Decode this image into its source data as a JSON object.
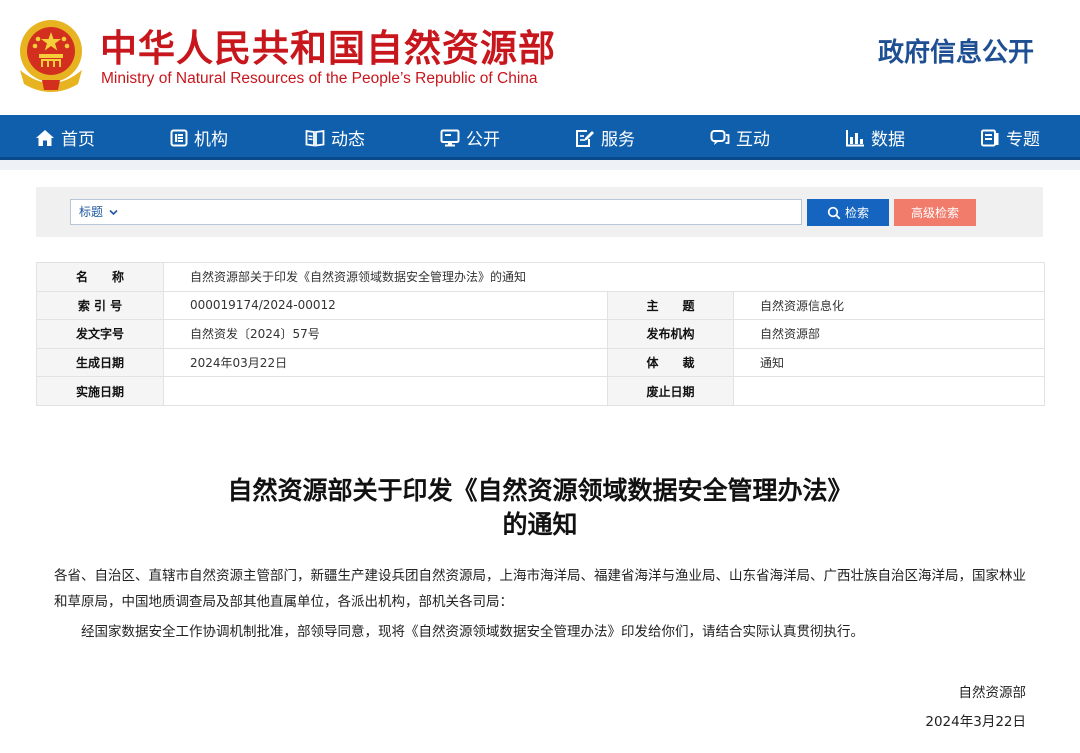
{
  "header": {
    "title": "中华人民共和国自然资源部",
    "subtitle": "Ministry of Natural Resources of the People’s Republic of China",
    "gov_info": "政府信息公开"
  },
  "nav": {
    "items": [
      {
        "label": "首页",
        "icon": "home-icon"
      },
      {
        "label": "机构",
        "icon": "org-icon"
      },
      {
        "label": "动态",
        "icon": "book-icon"
      },
      {
        "label": "公开",
        "icon": "monitor-icon"
      },
      {
        "label": "服务",
        "icon": "edit-icon"
      },
      {
        "label": "互动",
        "icon": "chat-icon"
      },
      {
        "label": "数据",
        "icon": "bar-chart-icon"
      },
      {
        "label": "专题",
        "icon": "document-icon"
      }
    ]
  },
  "search": {
    "select_value": "标题",
    "input_value": "",
    "search_label": "检索",
    "advanced_label": "高级检索"
  },
  "meta": {
    "name_label": "名　　称",
    "name_value": "自然资源部关于印发《自然资源领域数据安全管理办法》的通知",
    "index_label": "索 引 号",
    "index_value": "000019174/2024-00012",
    "topic_label": "主　　题",
    "topic_value": "自然资源信息化",
    "docno_label": "发文字号",
    "docno_value": "自然资发〔2024〕57号",
    "publisher_label": "发布机构",
    "publisher_value": "自然资源部",
    "created_label": "生成日期",
    "created_value": "2024年03月22日",
    "genre_label": "体　　裁",
    "genre_value": "通知",
    "effective_label": "实施日期",
    "effective_value": "",
    "repeal_label": "废止日期",
    "repeal_value": ""
  },
  "article": {
    "title_line1": "自然资源部关于印发《自然资源领域数据安全管理办法》",
    "title_line2": "的通知",
    "recipients": "各省、自治区、直辖市自然资源主管部门，新疆生产建设兵团自然资源局，上海市海洋局、福建省海洋与渔业局、山东省海洋局、广西壮族自治区海洋局，国家林业和草原局，中国地质调查局及部其他直属单位，各派出机构，部机关各司局：",
    "body": "经国家数据安全工作协调机制批准，部领导同意，现将《自然资源领域数据安全管理办法》印发给你们，请结合实际认真贯彻执行。",
    "signer": "自然资源部",
    "date": "2024年3月22日"
  },
  "colors": {
    "brand_red": "#c8161d",
    "nav_blue": "#0f5fac",
    "gov_blue": "#1e4f93",
    "search_blue": "#1565c0",
    "advanced_salmon": "#f27c6c"
  }
}
